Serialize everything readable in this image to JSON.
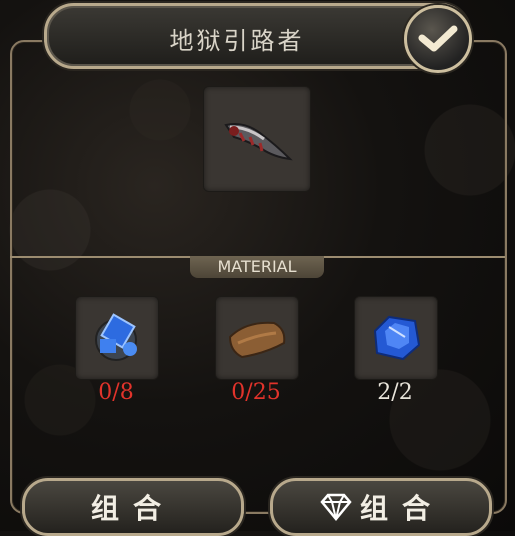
{
  "title": "地狱引路者",
  "material_label": "MATERIAL",
  "result_item": {
    "icon": "demon-blade-icon"
  },
  "materials": [
    {
      "icon": "blue-orb-crystal-icon",
      "count": "0/8",
      "count_color": "#e2332b"
    },
    {
      "icon": "leather-scrap-icon",
      "count": "0/25",
      "count_color": "#e2332b"
    },
    {
      "icon": "blue-gem-icon",
      "count": "2/2",
      "count_color": "#e8e4da"
    }
  ],
  "buttons": {
    "combine_label": "组合",
    "gem_combine_label": "组合"
  },
  "colors": {
    "accent": "#b8a98c",
    "insufficient": "#e2332b"
  }
}
